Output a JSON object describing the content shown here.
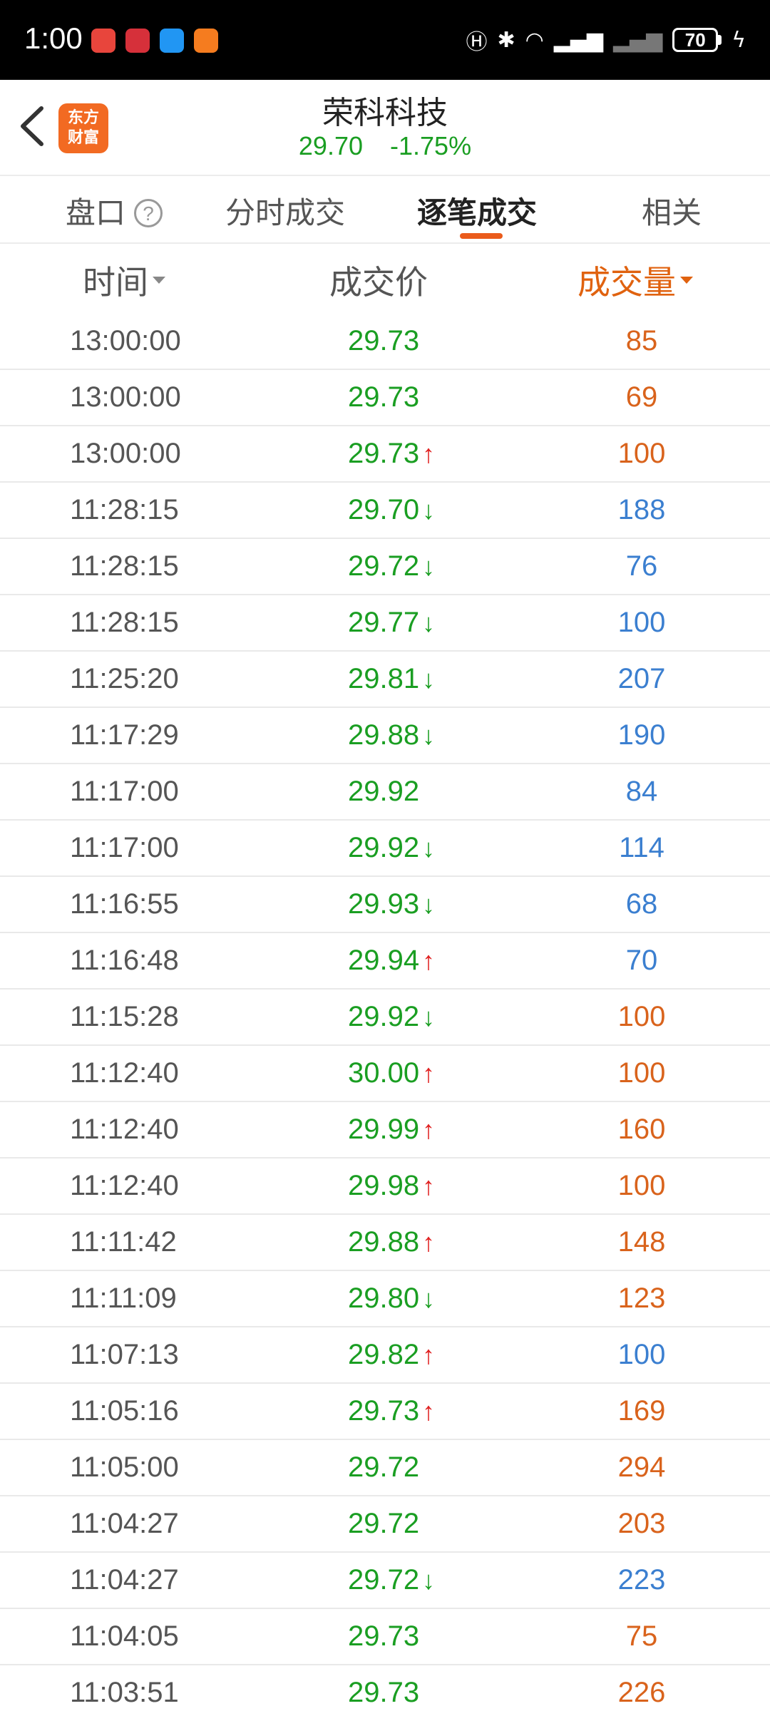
{
  "status_bar": {
    "time": "1:00",
    "battery": "70"
  },
  "header": {
    "logo_text": "东方财富",
    "logo_line1": "东方",
    "logo_line2": "财富",
    "stock_name": "荣科科技",
    "price": "29.70",
    "change_pct": "-1.75%"
  },
  "tabs": [
    {
      "label": "盘口"
    },
    {
      "label": "分时成交"
    },
    {
      "label": "逐笔成交"
    },
    {
      "label": "相关"
    }
  ],
  "columns": {
    "time": "时间",
    "price": "成交价",
    "volume": "成交量"
  },
  "colors": {
    "green": "#1a9e22",
    "red": "#e02020",
    "orange": "#e0620f",
    "blue": "#3b7fd0"
  },
  "rows": [
    {
      "time": "13:00:00",
      "price": "29.73",
      "dir": "",
      "vol": "85",
      "side": "buy"
    },
    {
      "time": "13:00:00",
      "price": "29.73",
      "dir": "",
      "vol": "69",
      "side": "buy"
    },
    {
      "time": "13:00:00",
      "price": "29.73",
      "dir": "up",
      "vol": "100",
      "side": "buy"
    },
    {
      "time": "11:28:15",
      "price": "29.70",
      "dir": "down",
      "vol": "188",
      "side": "sell"
    },
    {
      "time": "11:28:15",
      "price": "29.72",
      "dir": "down",
      "vol": "76",
      "side": "sell"
    },
    {
      "time": "11:28:15",
      "price": "29.77",
      "dir": "down",
      "vol": "100",
      "side": "sell"
    },
    {
      "time": "11:25:20",
      "price": "29.81",
      "dir": "down",
      "vol": "207",
      "side": "sell"
    },
    {
      "time": "11:17:29",
      "price": "29.88",
      "dir": "down",
      "vol": "190",
      "side": "sell"
    },
    {
      "time": "11:17:00",
      "price": "29.92",
      "dir": "",
      "vol": "84",
      "side": "sell"
    },
    {
      "time": "11:17:00",
      "price": "29.92",
      "dir": "down",
      "vol": "114",
      "side": "sell"
    },
    {
      "time": "11:16:55",
      "price": "29.93",
      "dir": "down",
      "vol": "68",
      "side": "sell"
    },
    {
      "time": "11:16:48",
      "price": "29.94",
      "dir": "up",
      "vol": "70",
      "side": "sell"
    },
    {
      "time": "11:15:28",
      "price": "29.92",
      "dir": "down",
      "vol": "100",
      "side": "buy"
    },
    {
      "time": "11:12:40",
      "price": "30.00",
      "dir": "up",
      "vol": "100",
      "side": "buy"
    },
    {
      "time": "11:12:40",
      "price": "29.99",
      "dir": "up",
      "vol": "160",
      "side": "buy"
    },
    {
      "time": "11:12:40",
      "price": "29.98",
      "dir": "up",
      "vol": "100",
      "side": "buy"
    },
    {
      "time": "11:11:42",
      "price": "29.88",
      "dir": "up",
      "vol": "148",
      "side": "buy"
    },
    {
      "time": "11:11:09",
      "price": "29.80",
      "dir": "down",
      "vol": "123",
      "side": "buy"
    },
    {
      "time": "11:07:13",
      "price": "29.82",
      "dir": "up",
      "vol": "100",
      "side": "sell"
    },
    {
      "time": "11:05:16",
      "price": "29.73",
      "dir": "up",
      "vol": "169",
      "side": "buy"
    },
    {
      "time": "11:05:00",
      "price": "29.72",
      "dir": "",
      "vol": "294",
      "side": "buy"
    },
    {
      "time": "11:04:27",
      "price": "29.72",
      "dir": "",
      "vol": "203",
      "side": "buy"
    },
    {
      "time": "11:04:27",
      "price": "29.72",
      "dir": "down",
      "vol": "223",
      "side": "sell"
    },
    {
      "time": "11:04:05",
      "price": "29.73",
      "dir": "",
      "vol": "75",
      "side": "buy"
    },
    {
      "time": "11:03:51",
      "price": "29.73",
      "dir": "",
      "vol": "226",
      "side": "buy"
    }
  ]
}
